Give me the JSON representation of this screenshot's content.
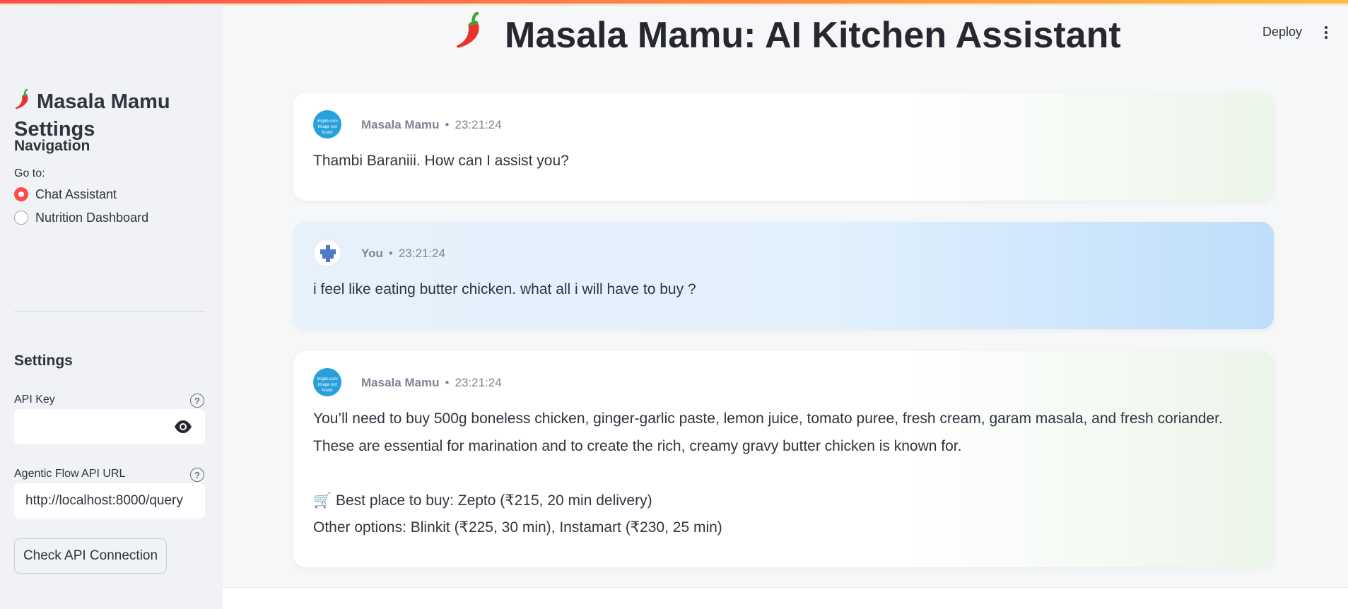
{
  "app": {
    "title": "Masala Mamu: AI Kitchen Assistant",
    "deploy_label": "Deploy"
  },
  "sidebar": {
    "title": "Masala Mamu Settings",
    "navigation": {
      "heading": "Navigation",
      "go_to_label": "Go to:",
      "options": [
        {
          "label": "Chat Assistant",
          "selected": true
        },
        {
          "label": "Nutrition Dashboard",
          "selected": false
        }
      ]
    },
    "settings": {
      "heading": "Settings",
      "api_key_label": "API Key",
      "api_key_value": "",
      "api_url_label": "Agentic Flow API URL",
      "api_url_value": "http://localhost:8000/query",
      "help_glyph": "?",
      "check_button": "Check API Connection"
    }
  },
  "chat": {
    "messages": [
      {
        "sender": "Masala Mamu",
        "time": "23:21:24",
        "avatar_text": "imgbb.com Image not found",
        "lines": [
          "Thambi Baraniii. How can I assist you?"
        ]
      },
      {
        "sender": "You",
        "time": "23:21:24",
        "lines": [
          "i feel like eating butter chicken. what all i will have to buy ?"
        ]
      },
      {
        "sender": "Masala Mamu",
        "time": "23:21:24",
        "avatar_text": "imgbb.com Image not found",
        "lines": [
          "You’ll need to buy 500g boneless chicken, ginger-garlic paste, lemon juice, tomato puree, fresh cream, garam masala, and fresh coriander.",
          "These are essential for marination and to create the rich, creamy gravy butter chicken is known for.",
          "",
          "🛒 Best place to buy: Zepto (₹215, 20 min delivery)",
          "Other options: Blinkit (₹225, 30 min), Instamart (₹230, 25 min)"
        ]
      }
    ]
  },
  "colors": {
    "accent": "#ff4b4b",
    "sidebar_bg": "#f0f2f6",
    "main_bg": "#f6f7f9",
    "user_card": "#bedefb",
    "ai_card_tint": "#ecf5ea"
  },
  "icons": {
    "chili": "chili-pepper-icon",
    "eye": "eye-icon",
    "help": "help-icon",
    "menu": "kebab-menu-icon",
    "cart": "shopping-cart-icon"
  }
}
